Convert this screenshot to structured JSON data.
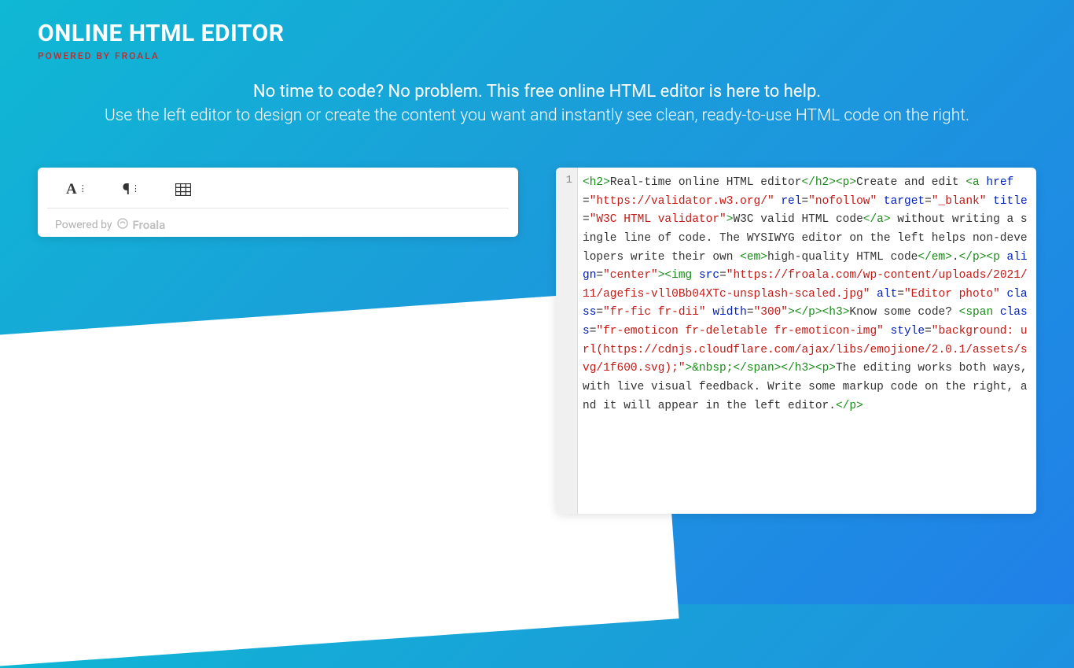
{
  "header": {
    "title": "ONLINE HTML EDITOR",
    "subtitle": "POWERED BY FROALA"
  },
  "intro": {
    "line1": "No time to code? No problem. This free online HTML editor is here to help.",
    "line2": "Use the left editor to design or create the content you want and instantly see clean, ready-to-use HTML code on the right."
  },
  "toolbar": {
    "text_glyph": "A",
    "paragraph_glyph": "¶",
    "icons": [
      "text-formatting",
      "paragraph-formatting",
      "insert-table"
    ]
  },
  "powered": {
    "prefix": "Powered by",
    "brand": "Froala"
  },
  "gutter": {
    "line1": "1"
  },
  "code_tokens": [
    {
      "t": "tag",
      "v": "<h2>"
    },
    {
      "t": "txt",
      "v": "Real-time online HTML editor"
    },
    {
      "t": "tag",
      "v": "</h2><p>"
    },
    {
      "t": "txt",
      "v": "Create and edit "
    },
    {
      "t": "tag",
      "v": "<a"
    },
    {
      "t": "txt",
      "v": " "
    },
    {
      "t": "attr",
      "v": "href"
    },
    {
      "t": "txt",
      "v": "="
    },
    {
      "t": "val",
      "v": "\"https://validator.w3.org/\""
    },
    {
      "t": "txt",
      "v": " "
    },
    {
      "t": "attr",
      "v": "rel"
    },
    {
      "t": "txt",
      "v": "="
    },
    {
      "t": "val",
      "v": "\"nofollow\""
    },
    {
      "t": "txt",
      "v": " "
    },
    {
      "t": "attr",
      "v": "target"
    },
    {
      "t": "txt",
      "v": "="
    },
    {
      "t": "val",
      "v": "\"_blank\""
    },
    {
      "t": "txt",
      "v": " "
    },
    {
      "t": "attr",
      "v": "title"
    },
    {
      "t": "txt",
      "v": "="
    },
    {
      "t": "val",
      "v": "\"W3C HTML validator\""
    },
    {
      "t": "tag",
      "v": ">"
    },
    {
      "t": "txt",
      "v": "W3C valid HTML code"
    },
    {
      "t": "tag",
      "v": "</a>"
    },
    {
      "t": "txt",
      "v": " without writing a single line of code. The WYSIWYG editor on the left helps non-developers write their own "
    },
    {
      "t": "tag",
      "v": "<em>"
    },
    {
      "t": "txt",
      "v": "high-quality HTML code"
    },
    {
      "t": "tag",
      "v": "</em>"
    },
    {
      "t": "txt",
      "v": "."
    },
    {
      "t": "tag",
      "v": "</p><p"
    },
    {
      "t": "txt",
      "v": " "
    },
    {
      "t": "attr",
      "v": "align"
    },
    {
      "t": "txt",
      "v": "="
    },
    {
      "t": "val",
      "v": "\"center\""
    },
    {
      "t": "tag",
      "v": "><img"
    },
    {
      "t": "txt",
      "v": " "
    },
    {
      "t": "attr",
      "v": "src"
    },
    {
      "t": "txt",
      "v": "="
    },
    {
      "t": "val",
      "v": "\"https://froala.com/wp-content/uploads/2021/11/agefis-vll0Bb04XTc-unsplash-scaled.jpg\""
    },
    {
      "t": "txt",
      "v": " "
    },
    {
      "t": "attr",
      "v": "alt"
    },
    {
      "t": "txt",
      "v": "="
    },
    {
      "t": "val",
      "v": "\"Editor photo\""
    },
    {
      "t": "txt",
      "v": " "
    },
    {
      "t": "attr",
      "v": "class"
    },
    {
      "t": "txt",
      "v": "="
    },
    {
      "t": "val",
      "v": "\"fr-fic fr-dii\""
    },
    {
      "t": "txt",
      "v": " "
    },
    {
      "t": "attr",
      "v": "width"
    },
    {
      "t": "txt",
      "v": "="
    },
    {
      "t": "val",
      "v": "\"300\""
    },
    {
      "t": "tag",
      "v": "></p><h3>"
    },
    {
      "t": "txt",
      "v": "Know some code? "
    },
    {
      "t": "tag",
      "v": "<span"
    },
    {
      "t": "txt",
      "v": " "
    },
    {
      "t": "attr",
      "v": "class"
    },
    {
      "t": "txt",
      "v": "="
    },
    {
      "t": "val",
      "v": "\"fr-emoticon fr-deletable fr-emoticon-img\""
    },
    {
      "t": "txt",
      "v": " "
    },
    {
      "t": "attr",
      "v": "style"
    },
    {
      "t": "txt",
      "v": "="
    },
    {
      "t": "val",
      "v": "\"background: url(https://cdnjs.cloudflare.com/ajax/libs/emojione/2.0.1/assets/svg/1f600.svg);\""
    },
    {
      "t": "tag",
      "v": ">"
    },
    {
      "t": "ent",
      "v": "&nbsp;"
    },
    {
      "t": "tag",
      "v": "</span></h3><p>"
    },
    {
      "t": "txt",
      "v": "The editing works both ways, with live visual feedback. Write some markup code on the right, and it will appear in the left editor."
    },
    {
      "t": "tag",
      "v": "</p>"
    }
  ]
}
